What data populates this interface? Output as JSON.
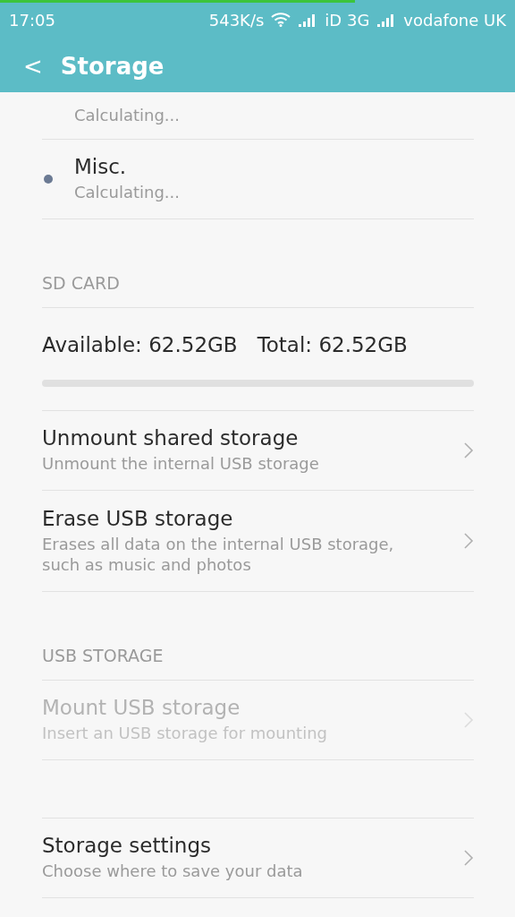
{
  "status_bar": {
    "time": "17:05",
    "speed": "543K/s",
    "network": "iD 3G",
    "carrier": "vodafone UK",
    "progress": {
      "level": 0.69
    }
  },
  "header": {
    "back": "<",
    "title": "Storage"
  },
  "storage_items": [
    {
      "subtitle": "Calculating..."
    },
    {
      "title": "Misc.",
      "subtitle": "Calculating...",
      "color": "#6b7a93"
    }
  ],
  "sd_card": {
    "heading": "SD CARD",
    "available": "Available: 62.52GB",
    "total": "Total: 62.52GB",
    "usage": {
      "level": 0
    }
  },
  "sd_actions": [
    {
      "title": "Unmount shared storage",
      "subtitle": "Unmount the internal USB storage",
      "disabled": false
    },
    {
      "title": "Erase USB storage",
      "subtitle": "Erases all data on the internal USB storage, such as music and photos",
      "disabled": false
    }
  ],
  "usb_storage": {
    "heading": "USB STORAGE",
    "items": [
      {
        "title": "Mount USB storage",
        "subtitle": "Insert an USB storage for mounting",
        "disabled": true
      }
    ]
  },
  "settings_items": [
    {
      "title": "Storage settings",
      "subtitle": "Choose where to save your data",
      "disabled": false
    }
  ]
}
